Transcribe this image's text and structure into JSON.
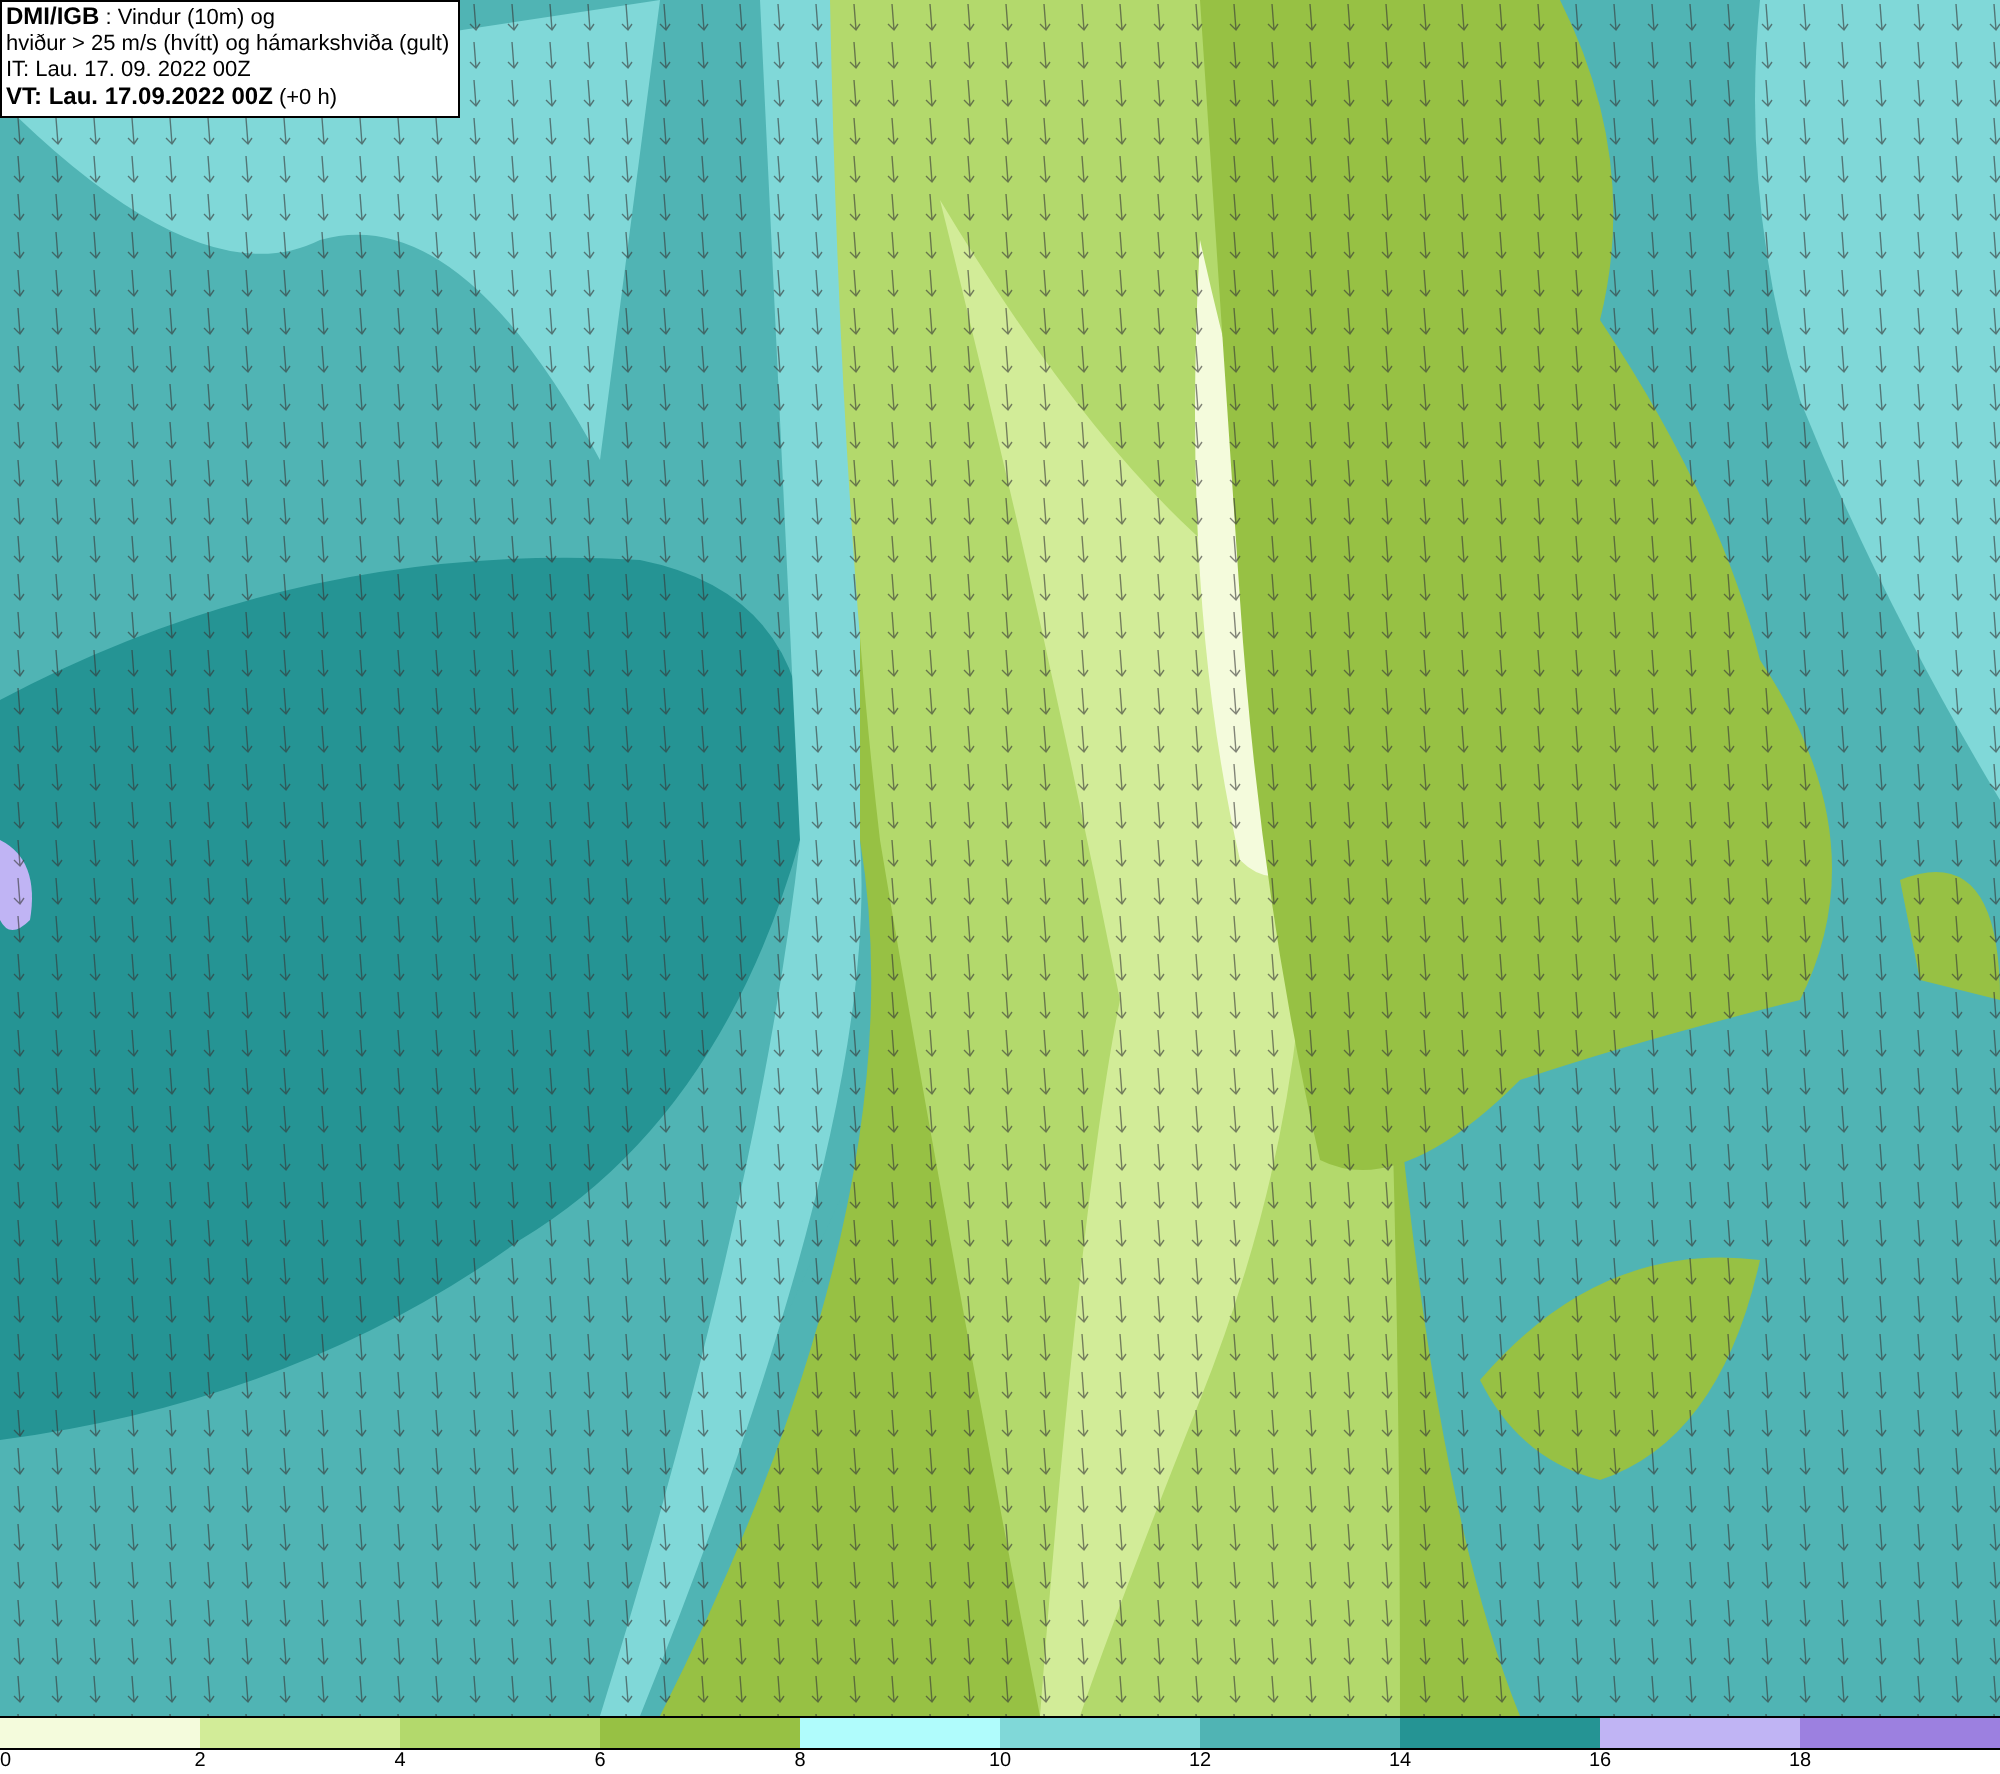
{
  "legend": {
    "lines": [
      "**DMI/IGB** : Vindur (10m) og",
      "hviður > 25 m/s (hvítt) og hámarkshviða (gult)",
      "IT: Lau. 17. 09. 2022 00Z",
      "**VT: Lau. 17.09.2022 00Z** (+0 h)"
    ]
  },
  "colorbar": {
    "segments": [
      {
        "color": "#f4fbdc"
      },
      {
        "color": "#d2ec98"
      },
      {
        "color": "#b3d96c"
      },
      {
        "color": "#97c144"
      },
      {
        "color": "#b0fcfc"
      },
      {
        "color": "#80d8d8"
      },
      {
        "color": "#50b4b4"
      },
      {
        "color": "#259494"
      },
      {
        "color": "#c0b4f4"
      },
      {
        "color": "#9c80e0"
      }
    ],
    "ticks": [
      "0",
      "2",
      "4",
      "6",
      "8",
      "10",
      "12",
      "14",
      "16",
      "18"
    ]
  }
}
